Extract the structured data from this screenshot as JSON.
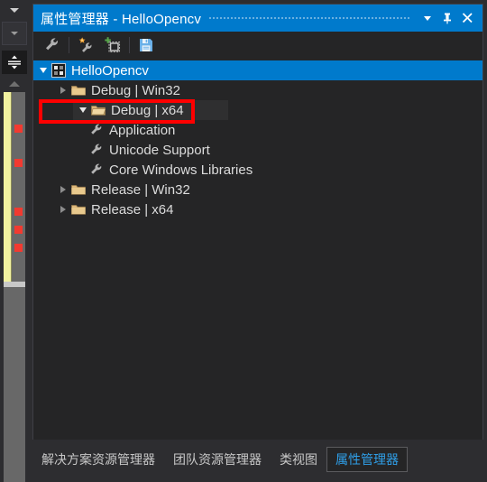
{
  "window": {
    "title_cn": "属性管理器",
    "title_sep": " - ",
    "title_project": "HelloOpencv",
    "dropdown_icon": "chevron-down-icon",
    "pin_icon": "pin-icon",
    "close_icon": "close-icon",
    "accent_color": "#007acc",
    "panel_bg": "#252526",
    "annotation_color": "#fe0000"
  },
  "toolbar": {
    "buttons": [
      {
        "name": "properties-wrench-button",
        "icon": "wrench-icon",
        "label": "属性"
      },
      {
        "name": "add-new-property-sheet-button",
        "icon": "wrench-sparkle-icon",
        "label": "添加新项目属性表"
      },
      {
        "name": "add-existing-property-sheet-button",
        "icon": "add-existing-icon",
        "label": "添加现有属性表"
      },
      {
        "name": "save-button",
        "icon": "save-floppy-icon",
        "label": "保存"
      }
    ]
  },
  "tree": {
    "nodes": [
      {
        "label": "HelloOpencv",
        "indent": 0,
        "state": "expanded",
        "icon": "solution-icon",
        "selected": true,
        "highlighted": false
      },
      {
        "label": "Debug | Win32",
        "indent": 1,
        "state": "collapsed",
        "icon": "folder-icon",
        "selected": false,
        "highlighted": false
      },
      {
        "label": "Debug | x64",
        "indent": 1,
        "state": "expanded",
        "icon": "folder-open-icon",
        "selected": false,
        "highlighted": true
      },
      {
        "label": "Application",
        "indent": 2,
        "state": "leaf",
        "icon": "wrench-icon",
        "selected": false,
        "highlighted": false
      },
      {
        "label": "Unicode Support",
        "indent": 2,
        "state": "leaf",
        "icon": "wrench-icon",
        "selected": false,
        "highlighted": false
      },
      {
        "label": "Core Windows Libraries",
        "indent": 2,
        "state": "leaf",
        "icon": "wrench-icon",
        "selected": false,
        "highlighted": false
      },
      {
        "label": "Release | Win32",
        "indent": 1,
        "state": "collapsed",
        "icon": "folder-icon",
        "selected": false,
        "highlighted": false
      },
      {
        "label": "Release | x64",
        "indent": 1,
        "state": "collapsed",
        "icon": "folder-icon",
        "selected": false,
        "highlighted": false
      }
    ]
  },
  "tabs": [
    {
      "label": "解决方案资源管理器",
      "active": false
    },
    {
      "label": "团队资源管理器",
      "active": false
    },
    {
      "label": "类视图",
      "active": false
    },
    {
      "label": "属性管理器",
      "active": true
    }
  ],
  "editor_strip": {
    "split_icon": "splitter-grip-icon",
    "scroll_up_icon": "scroll-up-arrow-icon",
    "scrollbar_mode": "map-mode",
    "error_marker_color": "#f23a30",
    "change_bar_color": "#f2f2a0",
    "error_markers_y": [
      140,
      178,
      232,
      252,
      272
    ]
  }
}
